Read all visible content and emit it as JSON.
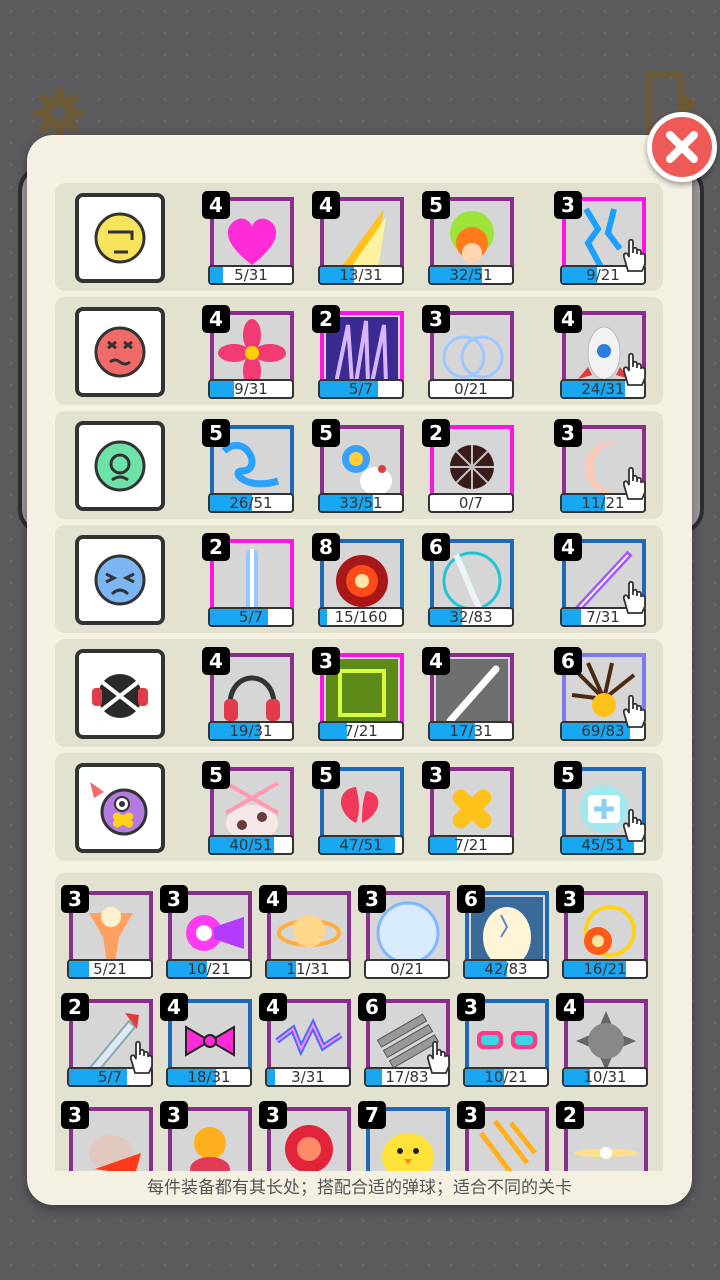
{
  "hint_text": "每件装备都有其长处；搭配合适的弹球；适合不同的关卡",
  "character_rows": [
    {
      "character_icon": "smirk-face-icon",
      "items": [
        {
          "level": "4",
          "progress_text": "5/31",
          "fraction": 0.16,
          "icon": "pink-heart-icon",
          "tier": "purple"
        },
        {
          "level": "4",
          "progress_text": "13/31",
          "fraction": 0.42,
          "icon": "golden-slash-icon",
          "tier": "purple"
        },
        {
          "level": "5",
          "progress_text": "32/51",
          "fraction": 0.63,
          "icon": "flame-burst-icon",
          "tier": "purple"
        },
        {
          "level": "3",
          "progress_text": "9/21",
          "fraction": 0.43,
          "icon": "blue-lightning-icon",
          "tier": "magenta",
          "hand": true
        }
      ]
    },
    {
      "character_icon": "angry-red-face-icon",
      "items": [
        {
          "level": "4",
          "progress_text": "9/31",
          "fraction": 0.29,
          "icon": "pink-flower-icon",
          "tier": "purple"
        },
        {
          "level": "2",
          "progress_text": "5/7",
          "fraction": 0.71,
          "icon": "violet-claws-icon",
          "tier": "magenta"
        },
        {
          "level": "3",
          "progress_text": "0/21",
          "fraction": 0,
          "icon": "bubble-rings-icon",
          "tier": "purple"
        },
        {
          "level": "4",
          "progress_text": "24/31",
          "fraction": 0.77,
          "icon": "rocket-icon",
          "tier": "purple",
          "hand": true
        }
      ]
    },
    {
      "character_icon": "sad-green-face-icon",
      "items": [
        {
          "level": "5",
          "progress_text": "26/51",
          "fraction": 0.51,
          "icon": "blue-swirl-icon",
          "tier": "blue"
        },
        {
          "level": "5",
          "progress_text": "33/51",
          "fraction": 0.65,
          "icon": "chicken-fire-icon",
          "tier": "purple"
        },
        {
          "level": "2",
          "progress_text": "0/7",
          "fraction": 0,
          "icon": "dark-vortex-icon",
          "tier": "magenta"
        },
        {
          "level": "3",
          "progress_text": "11/21",
          "fraction": 0.52,
          "icon": "crescent-moon-icon",
          "tier": "purple",
          "hand": true
        }
      ]
    },
    {
      "character_icon": "blue-frown-face-icon",
      "items": [
        {
          "level": "2",
          "progress_text": "5/7",
          "fraction": 0.71,
          "icon": "blue-beam-icon",
          "tier": "magenta"
        },
        {
          "level": "8",
          "progress_text": "15/160",
          "fraction": 0.09,
          "icon": "red-explosion-icon",
          "tier": "blue"
        },
        {
          "level": "6",
          "progress_text": "32/83",
          "fraction": 0.39,
          "icon": "sword-icon",
          "tier": "blue"
        },
        {
          "level": "4",
          "progress_text": "7/31",
          "fraction": 0.23,
          "icon": "purple-streak-icon",
          "tier": "blue",
          "hand": true
        }
      ]
    },
    {
      "character_icon": "headphone-face-icon",
      "items": [
        {
          "level": "4",
          "progress_text": "19/31",
          "fraction": 0.61,
          "icon": "headphones-icon",
          "tier": "purple"
        },
        {
          "level": "3",
          "progress_text": "7/21",
          "fraction": 0.33,
          "icon": "green-square-icon",
          "tier": "magenta"
        },
        {
          "level": "4",
          "progress_text": "17/31",
          "fraction": 0.55,
          "icon": "white-slash-icon",
          "tier": "purple"
        },
        {
          "level": "6",
          "progress_text": "69/83",
          "fraction": 0.83,
          "icon": "spark-burst-icon",
          "tier": "lilac",
          "hand": true
        }
      ]
    },
    {
      "character_icon": "bandaged-eye-face-icon",
      "items": [
        {
          "level": "5",
          "progress_text": "40/51",
          "fraction": 0.78,
          "icon": "cow-swords-icon",
          "tier": "purple"
        },
        {
          "level": "5",
          "progress_text": "47/51",
          "fraction": 0.92,
          "icon": "red-petal-icon",
          "tier": "blue"
        },
        {
          "level": "3",
          "progress_text": "7/21",
          "fraction": 0.33,
          "icon": "bandage-cross-icon",
          "tier": "purple"
        },
        {
          "level": "5",
          "progress_text": "45/51",
          "fraction": 0.88,
          "icon": "medkit-icon",
          "tier": "blue",
          "hand": true
        }
      ]
    }
  ],
  "inventory_rows": [
    [
      {
        "level": "3",
        "progress_text": "5/21",
        "fraction": 0.24,
        "icon": "fire-tornado-icon",
        "tier": "purple"
      },
      {
        "level": "3",
        "progress_text": "10/21",
        "fraction": 0.48,
        "icon": "purple-blast-icon",
        "tier": "purple"
      },
      {
        "level": "4",
        "progress_text": "11/31",
        "fraction": 0.35,
        "icon": "golden-ring-icon",
        "tier": "purple"
      },
      {
        "level": "3",
        "progress_text": "0/21",
        "fraction": 0,
        "icon": "bubble-orb-icon",
        "tier": "purple"
      },
      {
        "level": "6",
        "progress_text": "42/83",
        "fraction": 0.51,
        "icon": "cracked-egg-icon",
        "tier": "blue"
      },
      {
        "level": "3",
        "progress_text": "16/21",
        "fraction": 0.76,
        "icon": "fire-circle-icon",
        "tier": "purple"
      }
    ],
    [
      {
        "level": "2",
        "progress_text": "5/7",
        "fraction": 0.71,
        "icon": "missile-icon",
        "tier": "purple",
        "hand": true
      },
      {
        "level": "4",
        "progress_text": "18/31",
        "fraction": 0.58,
        "icon": "pink-bow-icon",
        "tier": "blue"
      },
      {
        "level": "4",
        "progress_text": "3/31",
        "fraction": 0.1,
        "icon": "blue-thunder-icon",
        "tier": "purple"
      },
      {
        "level": "6",
        "progress_text": "17/83",
        "fraction": 0.2,
        "icon": "gatling-gun-icon",
        "tier": "purple",
        "hand": true
      },
      {
        "level": "3",
        "progress_text": "10/21",
        "fraction": 0.48,
        "icon": "party-glasses-icon",
        "tier": "blue"
      },
      {
        "level": "4",
        "progress_text": "10/31",
        "fraction": 0.32,
        "icon": "spiked-ball-icon",
        "tier": "purple"
      }
    ],
    [
      {
        "level": "3",
        "progress_text": "",
        "fraction": 0,
        "icon": "flaming-bird-icon",
        "tier": "purple"
      },
      {
        "level": "3",
        "progress_text": "",
        "fraction": 0,
        "icon": "red-beetle-icon",
        "tier": "purple"
      },
      {
        "level": "3",
        "progress_text": "",
        "fraction": 0,
        "icon": "red-shield-icon",
        "tier": "purple"
      },
      {
        "level": "7",
        "progress_text": "",
        "fraction": 0,
        "icon": "yellow-chick-icon",
        "tier": "blue"
      },
      {
        "level": "3",
        "progress_text": "",
        "fraction": 0,
        "icon": "golden-claws-icon",
        "tier": "purple"
      },
      {
        "level": "2",
        "progress_text": "",
        "fraction": 0,
        "icon": "light-flare-icon",
        "tier": "purple"
      }
    ]
  ],
  "colors": {
    "progress_fill": "#1aa7f2",
    "close_button": "#ee5a55",
    "modal_bg": "#f4f1e3"
  }
}
